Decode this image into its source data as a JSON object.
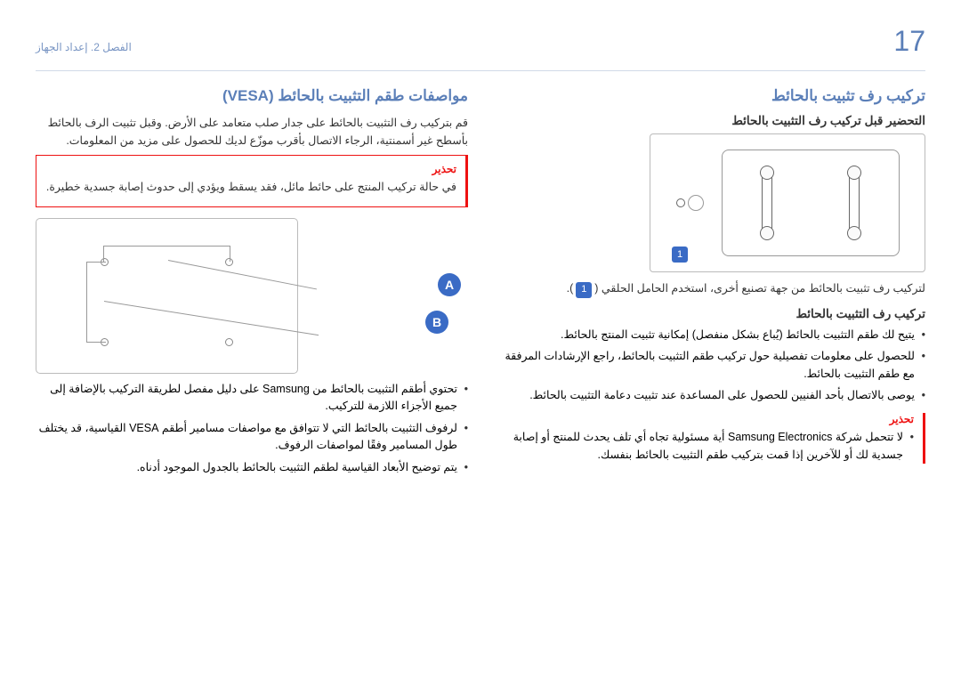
{
  "page_number": "17",
  "chapter_label": "الفصل 2. إعداد الجهاز",
  "right": {
    "h1": "تركيب رف تثبيت بالحائط",
    "h2_prep": "التحضير قبل تركيب رف التثبيت بالحائط",
    "fig1_callout": "1",
    "prep_text": "لتركيب رف تثبيت بالحائط من جهة تصنيع أخرى، استخدم الحامل الحلقي (",
    "prep_text_after": ").",
    "h2_install": "تركيب رف التثبيت بالحائط",
    "install_items": [
      "يتيح لك طقم التثبيت بالحائط (يُباع بشكل منفصل) إمكانية تثبيت المنتج بالحائط.",
      "للحصول على معلومات تفصيلية حول تركيب طقم التثبيت بالحائط، راجع الإرشادات المرفقة مع طقم التثبيت بالحائط.",
      "يوصى بالاتصال بأحد الفنيين للحصول على المساعدة عند تثبيت دعامة التثبيت بالحائط."
    ],
    "warn_title": "تحذير",
    "warn_items": [
      "لا تتحمل شركة Samsung Electronics أية مسئولية تجاه أي تلف يحدث للمنتج أو إصابة جسدية لك أو للآخرين إذا قمت بتركيب طقم التثبيت بالحائط بنفسك."
    ]
  },
  "left": {
    "h1": "مواصفات طقم التثبيت بالحائط (VESA)",
    "p1": "قم بتركيب رف التثبيت بالحائط على جدار صلب متعامد على الأرض. وقبل تثبيت الرف بالحائط بأسطح غير أسمنتية، الرجاء الاتصال بأقرب موزّع لديك للحصول على مزيد من المعلومات.",
    "warn_title": "تحذير",
    "warn_text": "في حالة تركيب المنتج على حائط مائل، فقد يسقط ويؤدي إلى حدوث إصابة جسدية خطيرة.",
    "letter_a": "A",
    "letter_b": "B",
    "spec_items": [
      "تحتوي أطقم التثبيت بالحائط من Samsung على دليل مفصل لطريقة التركيب بالإضافة إلى جميع الأجزاء اللازمة للتركيب.",
      "لرفوف التثبيت بالحائط التي لا تتوافق مع مواصفات مسامير أطقم VESA القياسية، قد يختلف طول المسامير وفقًا لمواصفات الرفوف.",
      "يتم توضيح الأبعاد القياسية لطقم التثبيت بالحائط بالجدول الموجود أدناه."
    ]
  }
}
